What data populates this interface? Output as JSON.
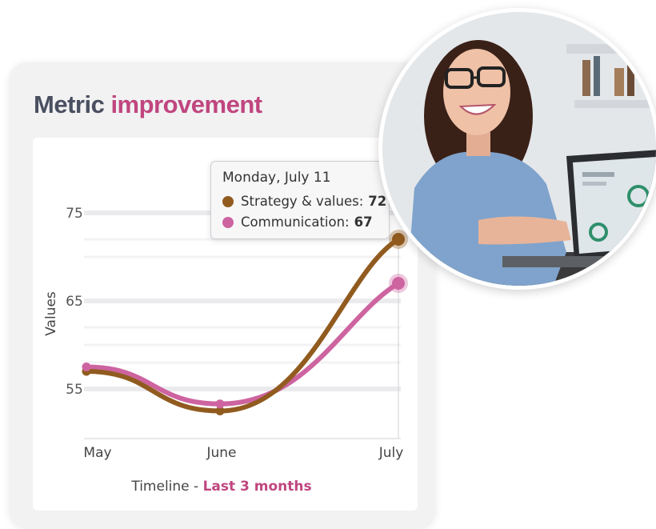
{
  "card": {
    "title_part1": "Metric",
    "title_part2": "improvement"
  },
  "tooltip": {
    "date": "Monday, July 11",
    "rows": [
      {
        "label": "Strategy & values:",
        "value": "72",
        "color": "#915b1f"
      },
      {
        "label": "Communication:",
        "value": "67",
        "color": "#cd64a0"
      }
    ]
  },
  "chart_data": {
    "type": "line",
    "x": [
      "May",
      "June",
      "July"
    ],
    "ylabel": "Values",
    "xlabel": "Timeline - ",
    "xlabel_highlight": "Last 3 months",
    "yticks": [
      55,
      65,
      75
    ],
    "ylim": [
      49,
      79
    ],
    "grid": true,
    "series": [
      {
        "name": "Strategy & values",
        "values": [
          57,
          52.5,
          72
        ],
        "color": "#915b1f"
      },
      {
        "name": "Communication",
        "values": [
          57.5,
          53.3,
          67
        ],
        "color": "#cd64a0"
      }
    ]
  },
  "photo": {
    "description_icon": "person-at-laptop-photo"
  }
}
